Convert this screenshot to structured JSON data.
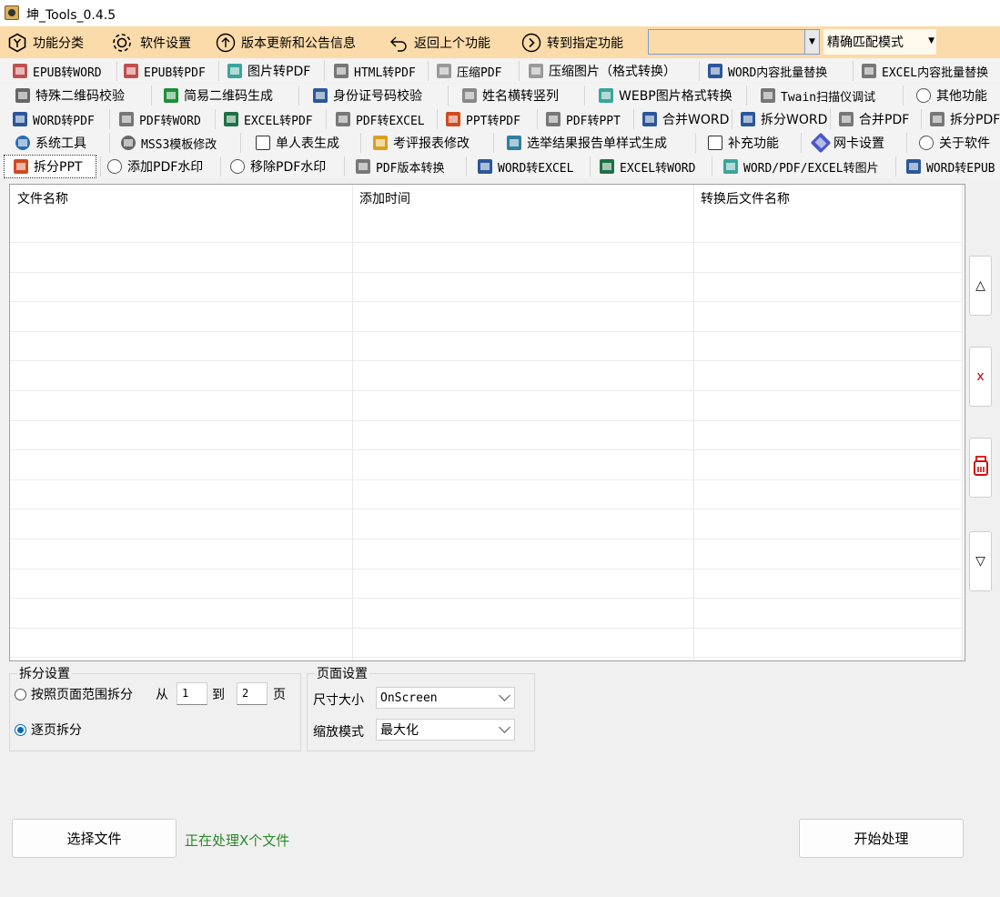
{
  "window": {
    "title": "坤_Tools_0.4.5"
  },
  "toolbar": {
    "category": "功能分类",
    "settings": "软件设置",
    "update": "版本更新和公告信息",
    "back": "返回上个功能",
    "goto": "转到指定功能",
    "search_value": "",
    "match_mode": "精确匹配模式"
  },
  "tabs": {
    "row1": [
      "EPUB转WORD",
      "EPUB转PDF",
      "图片转PDF",
      "HTML转PDF",
      "压缩PDF",
      "压缩图片（格式转换）",
      "WORD内容批量替换",
      "EXCEL内容批量替换"
    ],
    "row2": [
      "特殊二维码校验",
      "简易二维码生成",
      "身份证号码校验",
      "姓名横转竖列",
      "WEBP图片格式转换",
      "Twain扫描仪调试",
      "其他功能"
    ],
    "row3": [
      "WORD转PDF",
      "PDF转WORD",
      "EXCEL转PDF",
      "PDF转EXCEL",
      "PPT转PDF",
      "PDF转PPT",
      "合并WORD",
      "拆分WORD",
      "合并PDF",
      "拆分PDF"
    ],
    "row4": [
      "系统工具",
      "MSS3模板修改",
      "单人表生成",
      "考评报表修改",
      "选举结果报告单样式生成",
      "补充功能",
      "网卡设置",
      "关于软件"
    ],
    "row5": [
      "拆分PPT",
      "添加PDF水印",
      "移除PDF水印",
      "PDF版本转换",
      "WORD转EXCEL",
      "EXCEL转WORD",
      "WORD/PDF/EXCEL转图片",
      "WORD转EPUB"
    ]
  },
  "filelist": {
    "columns": [
      "文件名称",
      "添加时间",
      "转换后文件名称"
    ],
    "rows": []
  },
  "side_buttons": {
    "up": "△",
    "remove": "x",
    "clear": "clear-icon",
    "down": "▽"
  },
  "split": {
    "group_title": "拆分设置",
    "by_range": "按照页面范围拆分",
    "from": "从",
    "from_value": "1",
    "to": "到",
    "to_value": "2",
    "page_unit": "页",
    "per_page": "逐页拆分",
    "selected": "per_page"
  },
  "page": {
    "group_title": "页面设置",
    "size_label": "尺寸大小",
    "size_value": "OnScreen",
    "zoom_label": "缩放模式",
    "zoom_value": "最大化"
  },
  "actions": {
    "choose_file": "选择文件",
    "status": "正在处理X个文件",
    "start": "开始处理"
  },
  "colors": {
    "toolbar_bg": "#fbdba9",
    "status_green": "#2a8a2a",
    "accent_blue": "#0067c0"
  }
}
